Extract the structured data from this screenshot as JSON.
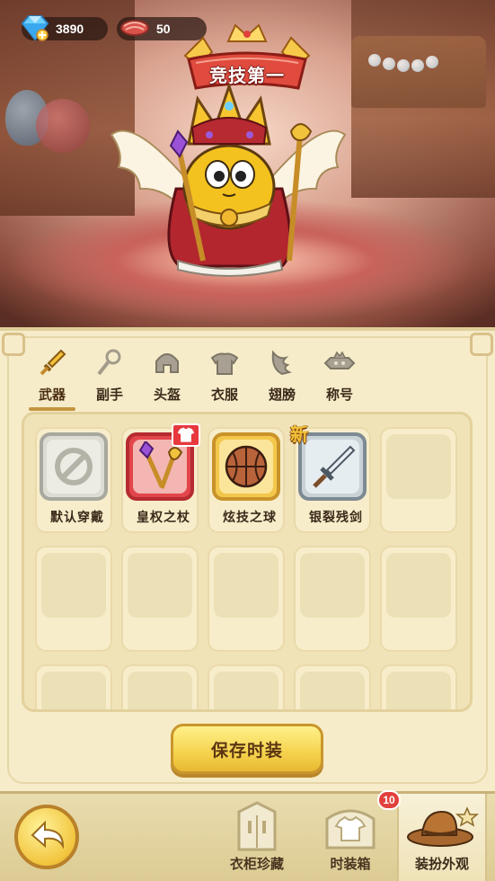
{
  "currency": {
    "gems": "3890",
    "meat": "50"
  },
  "title_badge": "竞技第一",
  "tabs": [
    {
      "label": "武器",
      "icon": "sword-icon",
      "active": true
    },
    {
      "label": "副手",
      "icon": "wand-icon",
      "active": false
    },
    {
      "label": "头盔",
      "icon": "helmet-icon",
      "active": false
    },
    {
      "label": "衣服",
      "icon": "armor-icon",
      "active": false
    },
    {
      "label": "翅膀",
      "icon": "wings-icon",
      "active": false
    },
    {
      "label": "称号",
      "icon": "title-plate-icon",
      "active": false
    }
  ],
  "items": [
    {
      "name": "默认穿戴",
      "frame": "gray",
      "icon": "no-entry-icon"
    },
    {
      "name": "皇权之杖",
      "frame": "red",
      "icon": "scepter-icon"
    },
    {
      "name": "炫技之球",
      "frame": "gold",
      "icon": "basketball-icon"
    },
    {
      "name": "银裂残剑",
      "frame": "silver",
      "icon": "broken-sword-icon",
      "tag": "新"
    }
  ],
  "save_button": "保存时装",
  "bottom_nav": [
    {
      "label": "衣柜珍藏",
      "icon": "wardrobe-icon"
    },
    {
      "label": "时装箱",
      "icon": "clothes-chest-icon",
      "badge": "10"
    },
    {
      "label": "装扮外观",
      "icon": "hat-icon",
      "active": true
    }
  ],
  "colors": {
    "panel_bg": "#f6ecc9",
    "accent_gold": "#f5d24c",
    "rare_red": "#e2454a"
  }
}
